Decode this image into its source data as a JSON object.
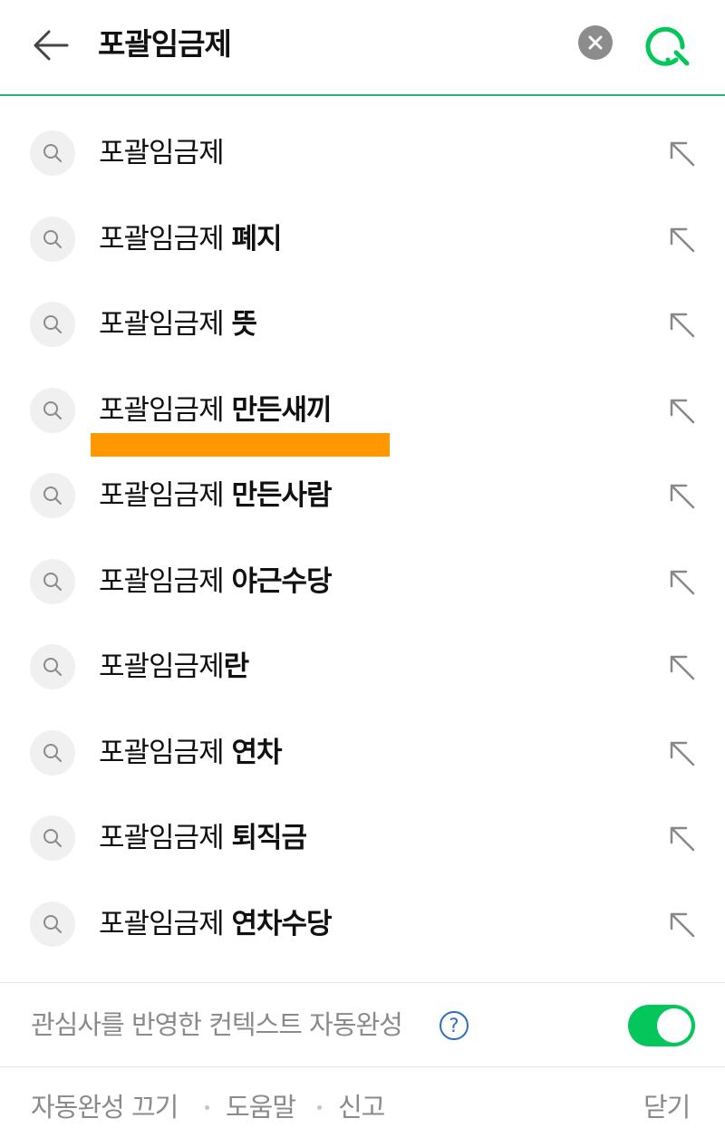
{
  "header": {
    "query": "포괄임금제",
    "back_icon": "arrow-left-icon",
    "clear_icon": "close-circle-icon",
    "search_icon": "search-icon",
    "accent_color": "#22b573"
  },
  "suggestions": [
    {
      "prefix": "포괄임금제",
      "rest": ""
    },
    {
      "prefix": "포괄임금제 ",
      "rest": "폐지"
    },
    {
      "prefix": "포괄임금제 ",
      "rest": "뜻"
    },
    {
      "prefix": "포괄임금제 ",
      "rest": "만든새끼"
    },
    {
      "prefix": "포괄임금제 ",
      "rest": "만든사람"
    },
    {
      "prefix": "포괄임금제 ",
      "rest": "야근수당"
    },
    {
      "prefix": "포괄임금제",
      "rest": "란"
    },
    {
      "prefix": "포괄임금제 ",
      "rest": "연차"
    },
    {
      "prefix": "포괄임금제 ",
      "rest": "퇴직금"
    },
    {
      "prefix": "포괄임금제 ",
      "rest": "연차수당"
    }
  ],
  "highlight": {
    "color": "#ff9800"
  },
  "context_autocomplete": {
    "label": "관심사를 반영한 컨텍스트 자동완성",
    "help_symbol": "?",
    "enabled": true,
    "toggle_color": "#03c75a"
  },
  "footer": {
    "autocomplete_off": "자동완성 끄기",
    "help": "도움말",
    "report": "신고",
    "close": "닫기"
  }
}
